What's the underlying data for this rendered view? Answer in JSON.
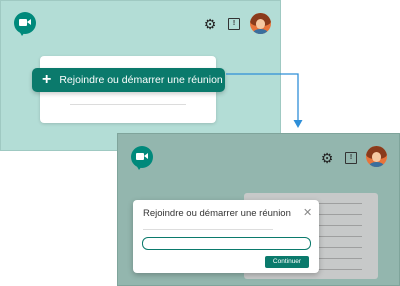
{
  "top_screen": {
    "logo_icon": "google-meet-logo",
    "settings_icon": "gear-icon",
    "feedback_icon": "feedback-icon",
    "feedback_glyph": "!",
    "avatar_icon": "user-avatar",
    "join_button": {
      "icon": "plus-icon",
      "plus_glyph": "+",
      "label": "Rejoindre ou démarrer une réunion"
    }
  },
  "bottom_screen": {
    "logo_icon": "google-meet-logo",
    "settings_icon": "gear-icon",
    "feedback_icon": "feedback-icon",
    "feedback_glyph": "!",
    "avatar_icon": "user-avatar",
    "dialog": {
      "title": "Rejoindre ou démarrer une réunion",
      "close_glyph": "✕",
      "input_value": "",
      "continue_label": "Continuer"
    }
  },
  "colors": {
    "accent": "#0b7a6c",
    "top_background": "#b3ddd6",
    "bottom_background": "#93b6ae",
    "arrow": "#2f8fd8"
  }
}
